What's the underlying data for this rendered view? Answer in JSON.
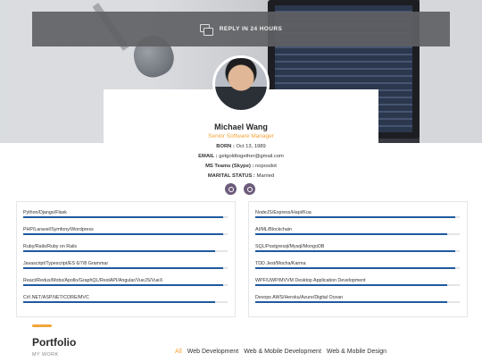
{
  "banner": {
    "text": "REPLY IN 24 HOURS",
    "icon": "chat-icon"
  },
  "profile": {
    "name": "Michael Wang",
    "role": "Senior Software Manager",
    "born_label": "BORN :",
    "born": "Oct 13, 1989",
    "email_label": "EMAIL :",
    "email": "getgoldtogether@gmail.com",
    "teams_label": "MS Teams (Skype) :",
    "teams": "noposdot",
    "marital_label": "MARITAL STATUS :",
    "marital": "Married",
    "links": [
      "github-icon",
      "globe-icon"
    ]
  },
  "skills_left": [
    {
      "label": "Python/Django/Flask",
      "level": 0.98
    },
    {
      "label": "PHP/Laravel/Symfony/Wordpress",
      "level": 0.98
    },
    {
      "label": "Ruby/Rails/Ruby on Rails",
      "level": 0.94
    },
    {
      "label": "Javascript/Typescript/ES 6/7/8 Grammar",
      "level": 0.98
    },
    {
      "label": "React/Redux/Mobx/Apollo/GraphQL/RestAPI/Angular/VueJS/VueX",
      "level": 0.98
    },
    {
      "label": "C#/.NET/ASP.NET/CORE/MVC",
      "level": 0.94
    }
  ],
  "skills_right": [
    {
      "label": "NodeJS/Express/Hapi/Koa",
      "level": 0.98
    },
    {
      "label": "AI/ML/Blockchain",
      "level": 0.94
    },
    {
      "label": "SQL/Postgresql/Mysql/MongoDB",
      "level": 0.98
    },
    {
      "label": "TDD Jest/Mocha/Karma",
      "level": 0.98
    },
    {
      "label": "WPF/UWP/MVVM Desktop Application Development",
      "level": 0.94
    },
    {
      "label": "Devops AWS/Heroku/Azure/Digital Ocean",
      "level": 0.94
    }
  ],
  "portfolio": {
    "title": "Portfolio",
    "subtitle": "MY WORK",
    "filters": [
      "All",
      "Web Development",
      "Web & Mobile Development",
      "Web & Mobile Design"
    ]
  },
  "colors": {
    "accent": "#f2a43a",
    "bar": "#1e5aa0",
    "icon_bg": "#6c5b7b"
  }
}
